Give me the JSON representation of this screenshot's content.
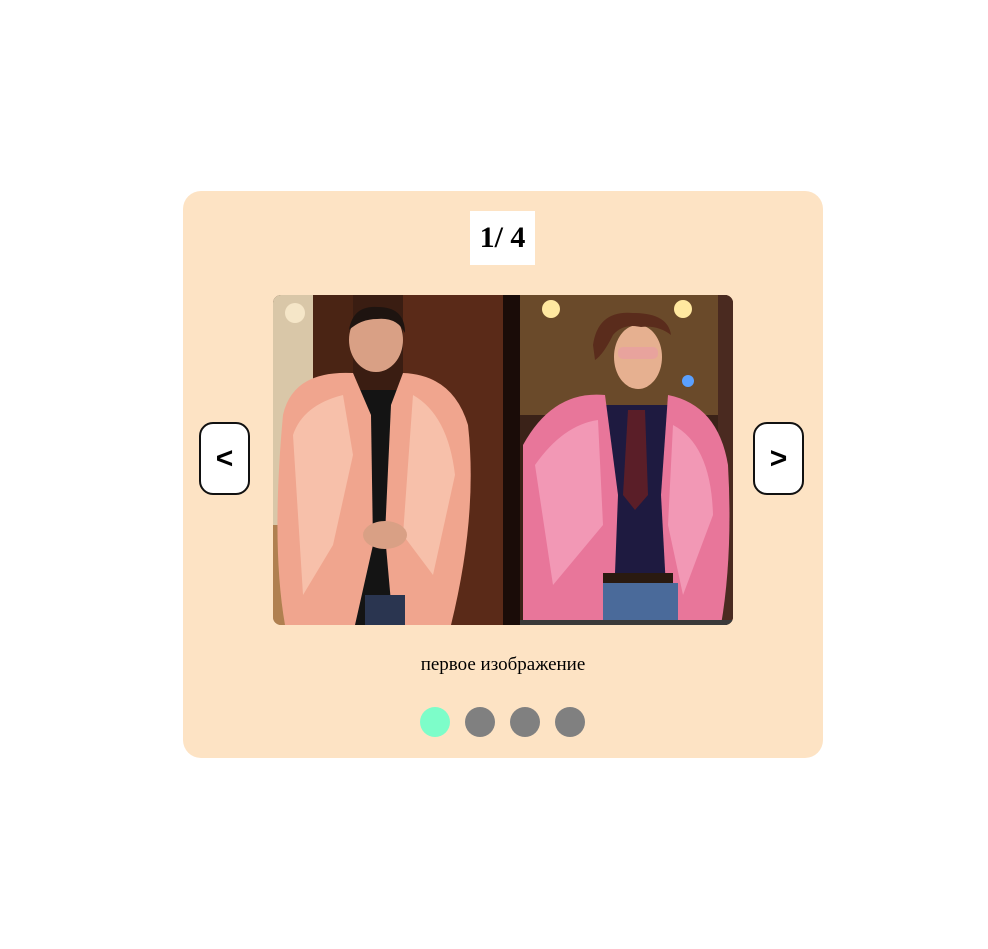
{
  "slider": {
    "counter": "1/ 4",
    "prev_label": "<",
    "next_label": ">",
    "caption": "первое изображение",
    "current_index": 1,
    "total": 4,
    "image_description_icon": "photo-and-anime-portrait-in-pink-fur-coat",
    "dots": [
      {
        "active": true
      },
      {
        "active": false
      },
      {
        "active": false
      },
      {
        "active": false
      }
    ],
    "colors": {
      "card_background": "#fde3c4",
      "dot_active": "#7dfdc9",
      "dot_inactive": "#808080"
    }
  }
}
